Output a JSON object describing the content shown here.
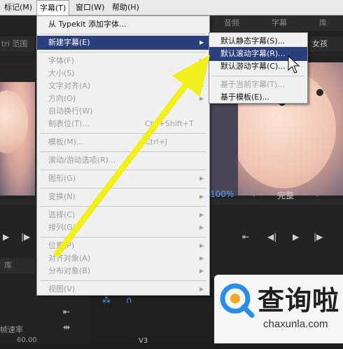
{
  "menubar": {
    "items": [
      "标记(M)",
      "字幕(T)",
      "窗口(W)",
      "帮助(H)"
    ]
  },
  "panels": {
    "source_tabs": [
      "音频",
      "字幕",
      "库"
    ],
    "left_label": "tri 范围",
    "right_label": "女孩",
    "zoom": "100%",
    "quality": "完整",
    "lib_label": "库",
    "speed_label": "帧速率",
    "speed_value": "60.00",
    "track_label": "V3"
  },
  "title_menu": {
    "items": [
      {
        "label": "从 Typekit 添加字体...",
        "shortcut": "",
        "submenu": false,
        "enabled": true
      },
      {
        "label": "新建字幕(E)",
        "shortcut": "",
        "submenu": true,
        "enabled": true,
        "highlighted": true
      },
      {
        "label": "字体(F)",
        "shortcut": "",
        "submenu": true,
        "enabled": false
      },
      {
        "label": "大小(S)",
        "shortcut": "",
        "submenu": true,
        "enabled": false
      },
      {
        "label": "文字对齐(A)",
        "shortcut": "",
        "submenu": true,
        "enabled": false
      },
      {
        "label": "方向(O)",
        "shortcut": "",
        "submenu": true,
        "enabled": false
      },
      {
        "label": "自动换行(W)",
        "shortcut": "",
        "submenu": false,
        "enabled": false
      },
      {
        "label": "制表位(T)...",
        "shortcut": "Ctrl+Shift+T",
        "submenu": false,
        "enabled": false
      },
      {
        "label": "模板(M)...",
        "shortcut": "Ctrl+J",
        "submenu": false,
        "enabled": false
      },
      {
        "label": "滚动/游动选项(R)...",
        "shortcut": "",
        "submenu": false,
        "enabled": false
      },
      {
        "label": "图形(G)",
        "shortcut": "",
        "submenu": true,
        "enabled": false
      },
      {
        "label": "变换(N)",
        "shortcut": "",
        "submenu": true,
        "enabled": false
      },
      {
        "label": "选择(C)",
        "shortcut": "",
        "submenu": true,
        "enabled": false
      },
      {
        "label": "排列(G)",
        "shortcut": "",
        "submenu": true,
        "enabled": false
      },
      {
        "label": "位置(P)",
        "shortcut": "",
        "submenu": true,
        "enabled": false
      },
      {
        "label": "对齐对象(A)",
        "shortcut": "",
        "submenu": true,
        "enabled": false
      },
      {
        "label": "分布对象(B)",
        "shortcut": "",
        "submenu": true,
        "enabled": false
      },
      {
        "label": "视图(V)",
        "shortcut": "",
        "submenu": true,
        "enabled": false
      }
    ]
  },
  "new_title_submenu": {
    "items": [
      {
        "label": "默认静态字幕(S)...",
        "enabled": true,
        "highlighted": false
      },
      {
        "label": "默认滚动字幕(R)...",
        "enabled": true,
        "highlighted": true
      },
      {
        "label": "默认游动字幕(C)...",
        "enabled": true,
        "highlighted": false
      },
      {
        "label": "基于当前字幕(T)...",
        "enabled": false,
        "highlighted": false
      },
      {
        "label": "基于模板(E)...",
        "enabled": true,
        "highlighted": false
      }
    ]
  },
  "watermark": {
    "title": "查询啦",
    "url": "chaxunla.com"
  },
  "colors": {
    "menu_highlight": "#2b3f7c",
    "arrow_yellow": "#f2ef1e",
    "watermark_blue": "#2a8ee8"
  }
}
